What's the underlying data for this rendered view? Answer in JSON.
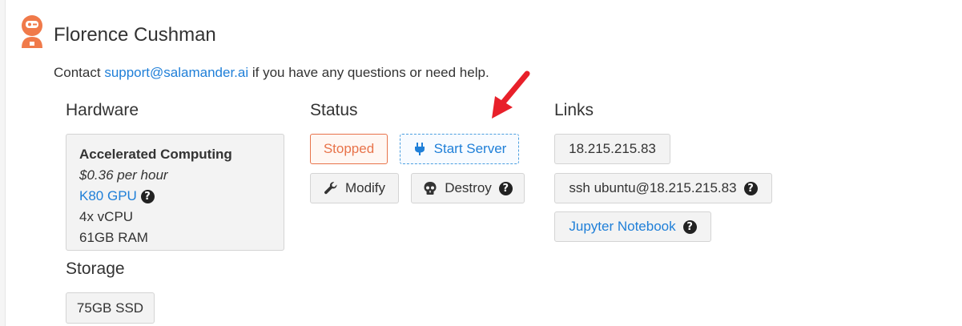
{
  "header": {
    "title": "Florence Cushman",
    "contact_prefix": "Contact ",
    "contact_email": "support@salamander.ai",
    "contact_suffix": " if you have any questions or need help."
  },
  "hardware": {
    "heading": "Hardware",
    "type": "Accelerated Computing",
    "price": "$0.36 per hour",
    "gpu": "K80 GPU",
    "cpu": "4x vCPU",
    "ram": "61GB RAM"
  },
  "storage": {
    "heading": "Storage",
    "size": "75GB SSD"
  },
  "status": {
    "heading": "Status",
    "state": "Stopped",
    "start_label": "Start Server",
    "modify_label": "Modify",
    "destroy_label": "Destroy"
  },
  "links": {
    "heading": "Links",
    "ip": "18.215.215.83",
    "ssh": "ssh ubuntu@18.215.215.83",
    "jupyter": "Jupyter Notebook"
  },
  "colors": {
    "accent_blue": "#1f7fd8",
    "stopped_orange": "#e8734a",
    "logo_orange": "#f07a4a",
    "arrow_red": "#e8202a"
  },
  "icons": {
    "logo": "salamander-logo-icon",
    "start": "plug-icon",
    "modify": "wrench-icon",
    "destroy": "skull-icon",
    "help": "question-circle-icon",
    "annotation": "red-arrow-icon"
  }
}
